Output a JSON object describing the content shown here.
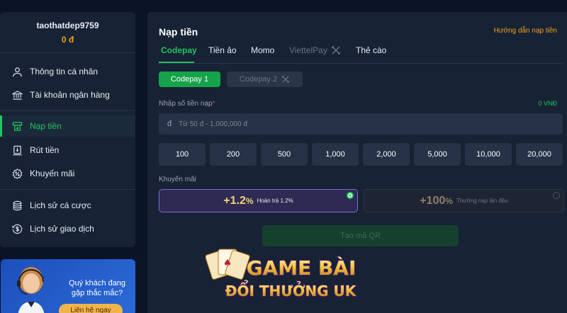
{
  "sidebar": {
    "username": "taothatdep9759",
    "balance": "0 đ",
    "items": [
      {
        "label": "Thông tin cá nhân",
        "icon": "user-icon"
      },
      {
        "label": "Tài khoản ngân hàng",
        "icon": "bank-icon"
      },
      {
        "label": "Nạp tiền",
        "icon": "deposit-icon",
        "active": true
      },
      {
        "label": "Rút tiền",
        "icon": "withdraw-icon"
      },
      {
        "label": "Khuyến mãi",
        "icon": "promo-icon"
      },
      {
        "label": "Lịch sử cá cược",
        "icon": "coins-icon"
      },
      {
        "label": "Lịch sử giao dịch",
        "icon": "dollar-history-icon"
      }
    ]
  },
  "support": {
    "question": "Quý khách đang gặp thắc mắc?",
    "button": "Liên hệ ngay"
  },
  "main": {
    "title": "Nạp tiền",
    "guide_link": "Hướng dẫn nạp tiền",
    "tabs": [
      {
        "label": "Codepay",
        "state": "active"
      },
      {
        "label": "Tiền ảo",
        "state": "normal"
      },
      {
        "label": "Momo",
        "state": "normal"
      },
      {
        "label": "ViettelPay",
        "state": "disabled"
      },
      {
        "label": "Thẻ cào",
        "state": "normal"
      }
    ],
    "subtabs": [
      {
        "label": "Codepay 1",
        "state": "active"
      },
      {
        "label": "Codepay 2",
        "state": "disabled"
      }
    ],
    "amount_label": "Nhập số tiền nạp",
    "amount_current": "0 VNĐ",
    "currency_symbol": "đ",
    "amount_placeholder": "Từ 50 đ - 1,000,000 đ",
    "quick_amounts": [
      "100",
      "200",
      "500",
      "1,000",
      "2,000",
      "5,000",
      "10,000",
      "20,000"
    ],
    "promo_label": "Khuyến mãi",
    "promos": [
      {
        "value": "+1.2",
        "unit": "%",
        "desc": "Hoàn trả 1.2%",
        "selected": true
      },
      {
        "value": "+100",
        "unit": "%",
        "desc": "Thưởng nạp lần đầu",
        "selected": false
      }
    ],
    "qr_button": "Tạo mã QR"
  },
  "banner": {
    "line1": "GAME BÀI",
    "line2": "ĐỔI THƯỞNG UK"
  },
  "colors": {
    "accent_green": "#22c55e",
    "accent_orange": "#f0a21a",
    "panel_bg": "#172235",
    "page_bg": "#0a1426",
    "promo_selected": "#7c6bd6"
  }
}
